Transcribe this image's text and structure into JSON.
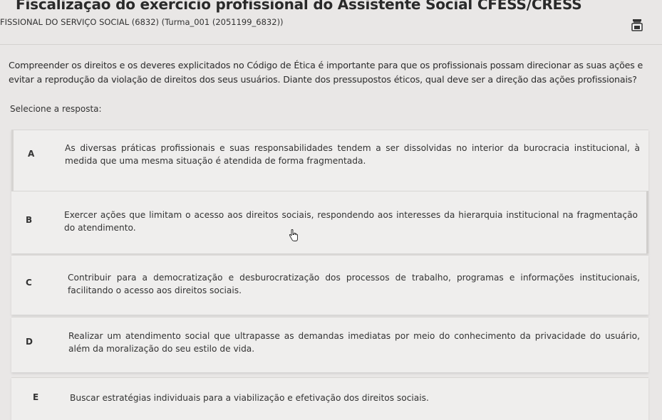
{
  "header": {
    "title": "Fiscalização do exercício profissional do Assistente Social CFESS/CRESS",
    "course": "FISSIONAL DO SERVIÇO SOCIAL (6832) (Turma_001 (2051199_6832))",
    "icon": "timer-icon"
  },
  "question": {
    "text": "Compreender os direitos e os deveres explicitados no Código de Ética é importante para que os profissionais possam direcionar as suas ações e evitar a reprodução da violação de direitos dos seus usuários. Diante dos pressupostos éticos, qual deve ser a direção das ações profissionais?",
    "prompt": "Selecione a resposta:"
  },
  "options": [
    {
      "letter": "A",
      "text": "As diversas práticas profissionais e suas responsabilidades tendem a ser dissolvidas no interior da burocracia institucional, à medida que uma mesma situação é atendida de forma fragmentada."
    },
    {
      "letter": "B",
      "text": "Exercer ações que limitam o acesso aos direitos sociais, respondendo aos interesses da hierarquia institucional na fragmentação do atendimento."
    },
    {
      "letter": "C",
      "text": "Contribuir para a democratização e desburocratização dos processos de trabalho, programas e informações institucionais, facilitando o acesso aos direitos sociais."
    },
    {
      "letter": "D",
      "text": "Realizar um atendimento social que ultrapasse as demandas imediatas por meio do conhecimento da privacidade do usuário, além da moralização do seu estilo de vida."
    },
    {
      "letter": "E",
      "text": "Buscar estratégias individuais para a viabilização e efetivação dos direitos sociais."
    }
  ],
  "colors": {
    "background": "#e9e7e6",
    "option_bg": "#efeeed",
    "text": "#2d2d2d"
  }
}
